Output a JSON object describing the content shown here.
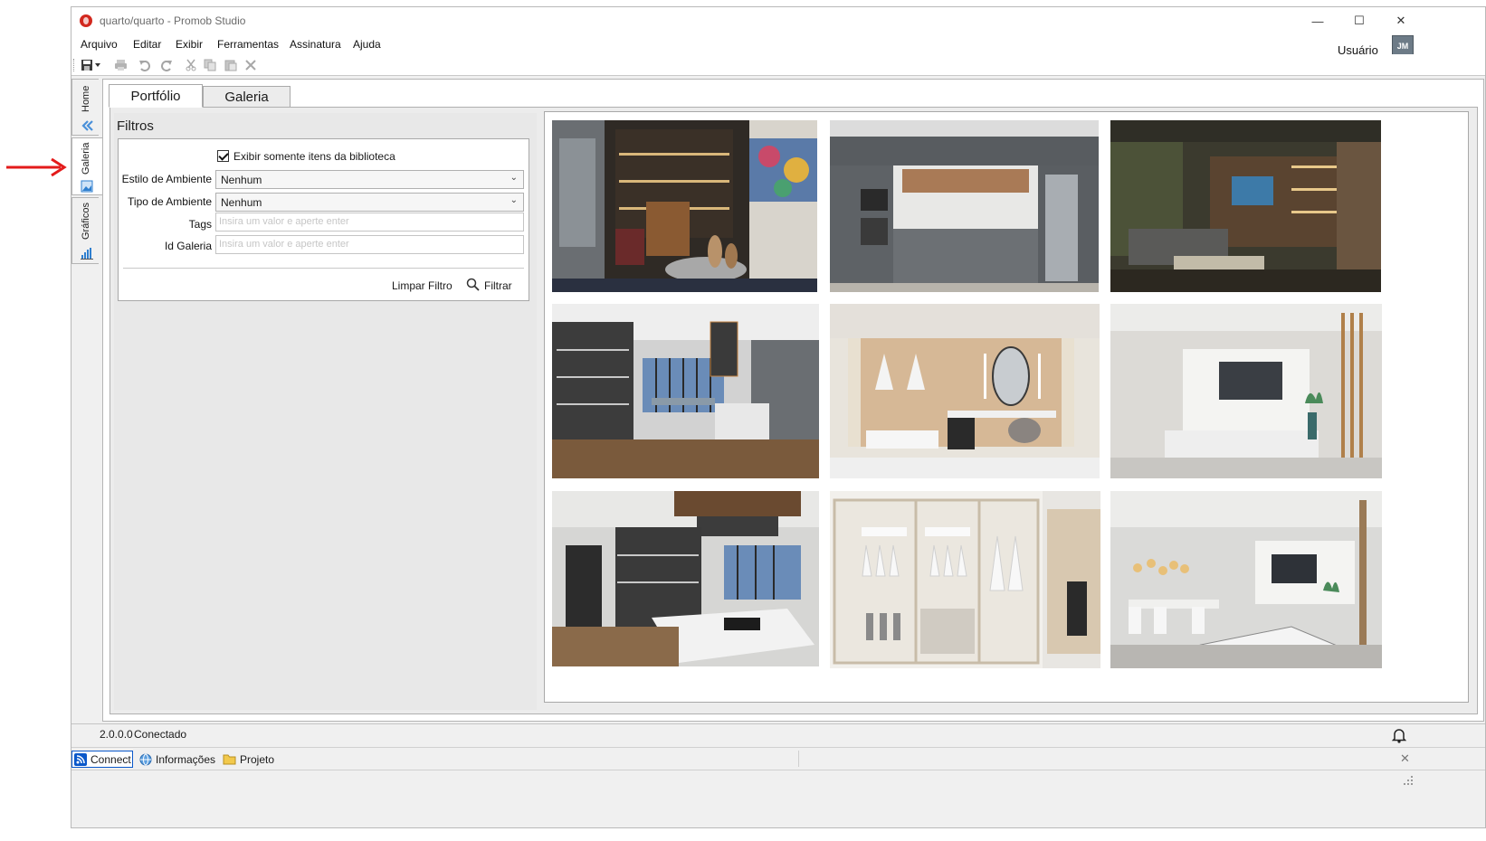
{
  "window": {
    "title": "quarto/quarto - Promob Studio",
    "controls": {
      "minimize": "—",
      "maximize": "☐",
      "close": "✕"
    }
  },
  "menu": [
    "Arquivo",
    "Editar",
    "Exibir",
    "Ferramentas",
    "Assinatura",
    "Ajuda"
  ],
  "user": {
    "label": "Usuário",
    "initials": "JM"
  },
  "side_tabs": [
    {
      "label": "Home",
      "icon": "home-arrows-icon"
    },
    {
      "label": "Galeria",
      "icon": "gallery-icon",
      "active": true
    },
    {
      "label": "Gráficos",
      "icon": "bar-chart-icon"
    }
  ],
  "tabs": [
    {
      "label": "Portfólio",
      "active": true
    },
    {
      "label": "Galeria",
      "active": false
    }
  ],
  "filters": {
    "title": "Filtros",
    "checkbox_label": "Exibir somente itens da biblioteca",
    "checkbox_checked": true,
    "estilo_label": "Estilo de Ambiente",
    "estilo_value": "Nenhum",
    "tipo_label": "Tipo de Ambiente",
    "tipo_value": "Nenhum",
    "tags_label": "Tags",
    "tags_placeholder": "Insira um valor e aperte enter",
    "id_label": "Id Galeria",
    "id_placeholder": "Insira um valor e aperte enter",
    "clear_label": "Limpar Filtro",
    "filter_label": "Filtrar"
  },
  "gallery": {
    "items": [
      {
        "scene": "study-shelves"
      },
      {
        "scene": "kitchen-gray"
      },
      {
        "scene": "living-dark"
      },
      {
        "scene": "kitchen-window"
      },
      {
        "scene": "bedroom-closet"
      },
      {
        "scene": "tv-wall-white"
      },
      {
        "scene": "kitchen-island"
      },
      {
        "scene": "wardrobe"
      },
      {
        "scene": "living-dining"
      }
    ]
  },
  "status": {
    "version": "2.0.0.0",
    "connection": "Conectado"
  },
  "bottom_tabs": [
    {
      "label": "Connect",
      "icon": "rss-icon",
      "active": true
    },
    {
      "label": "Informações",
      "icon": "globe-icon"
    },
    {
      "label": "Projeto",
      "icon": "folder-icon"
    }
  ],
  "colors": {
    "annotation_arrow": "#e31b1b",
    "accent": "#0a58ca"
  }
}
